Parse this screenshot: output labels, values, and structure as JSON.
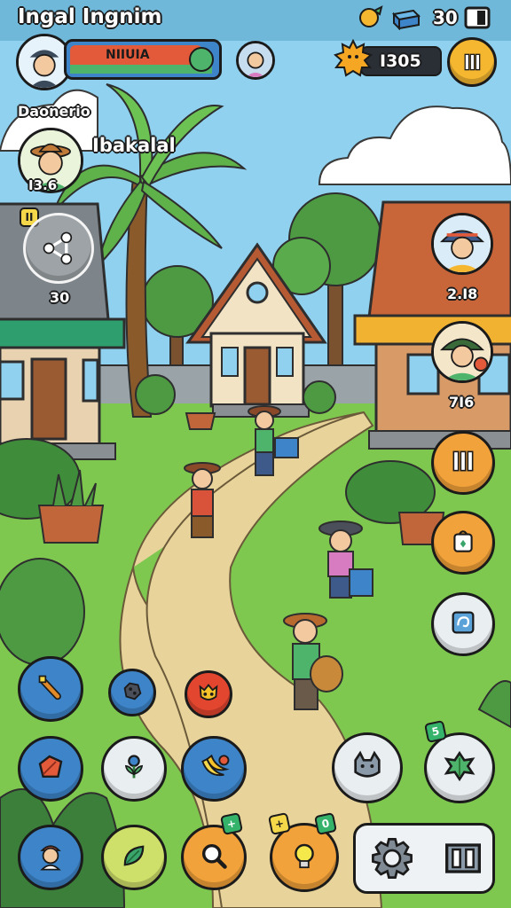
{
  "header": {
    "title": "Ingal Ingnim",
    "stat_value": "30",
    "coin_amount": "I305"
  },
  "player": {
    "name_bar_text": "NIIUIA",
    "name_label": "Daonerio",
    "xp_fraction": 0.9
  },
  "friend": {
    "name": "Ibakalal",
    "score": "I3.6"
  },
  "share": {
    "count_badge": "II",
    "count": "30"
  },
  "neighbors": [
    {
      "score": "2.I8"
    },
    {
      "score": "7I6"
    }
  ],
  "icons": {
    "top": [
      "sun-gem-icon",
      "crate-icon",
      "pause-square-icon"
    ],
    "side": [
      "bars-icon",
      "bag-icon",
      "map-tile-icon"
    ],
    "bottom": [
      "torch-icon",
      "ore-icon",
      "mask-icon",
      "leaf-card-icon",
      "flower-icon",
      "banana-icon",
      "cat-icon",
      "herb-icon",
      "character-icon",
      "leaf-icon",
      "magnifier-icon",
      "lightbulb-icon",
      "settings-icon",
      "inventory-icon"
    ]
  },
  "colors": {
    "sky": "#8fd1ef",
    "grass": "#7ec850",
    "path": "#e8d49a",
    "accent_orange": "#f2a23a",
    "accent_blue": "#3e84c8"
  }
}
